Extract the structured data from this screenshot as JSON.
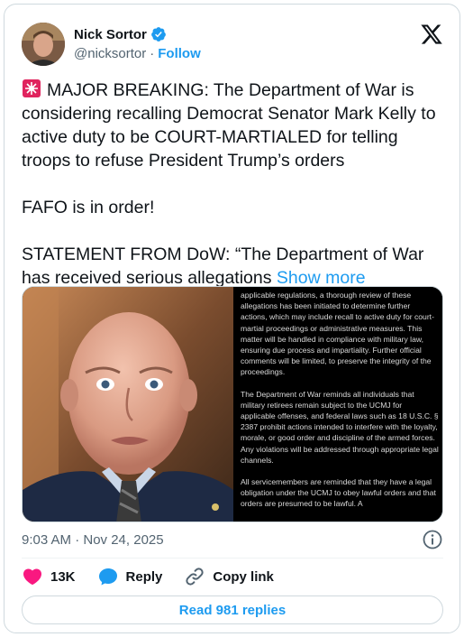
{
  "author": {
    "display_name": "Nick Sortor",
    "handle": "@nicksortor",
    "separator": "·",
    "follow_label": "Follow"
  },
  "tweet": {
    "line1": "MAJOR BREAKING: The Department of War is considering recalling Democrat Senator Mark Kelly to active duty to be COURT-MARTIALED for telling troops to refuse President Trump’s orders",
    "line2": "FAFO is in order!",
    "line3": "STATEMENT FROM DoW: “The Department of War has received serious allegations",
    "show_more": "Show more"
  },
  "media": {
    "statement_paragraphs": [
      "applicable regulations, a thorough review of these allegations has been initiated to determine further actions, which may include recall to active duty for court-martial proceedings or administrative measures. This matter will be handled in compliance with military law, ensuring due process and impartiality. Further official comments will be limited, to preserve the integrity of the proceedings.",
      "The Department of War reminds all individuals that military retirees remain subject to the UCMJ for applicable offenses, and federal laws such as 18 U.S.C. § 2387 prohibit actions intended to interfere with the loyalty, morale, or good order and discipline of the armed forces. Any violations will be addressed through appropriate legal channels.",
      "All servicemembers are reminded that they have a legal obligation under the UCMJ to obey lawful orders and that orders are presumed to be lawful. A"
    ]
  },
  "meta": {
    "timestamp": "9:03 AM · Nov 24, 2025"
  },
  "actions": {
    "like_count": "13K",
    "reply_label": "Reply",
    "copy_link_label": "Copy link"
  },
  "read_replies_label": "Read 981 replies",
  "colors": {
    "accent": "#1d9bf0",
    "like": "#f91880",
    "text": "#0f1419",
    "muted": "#536471",
    "border": "#cfd9de"
  }
}
